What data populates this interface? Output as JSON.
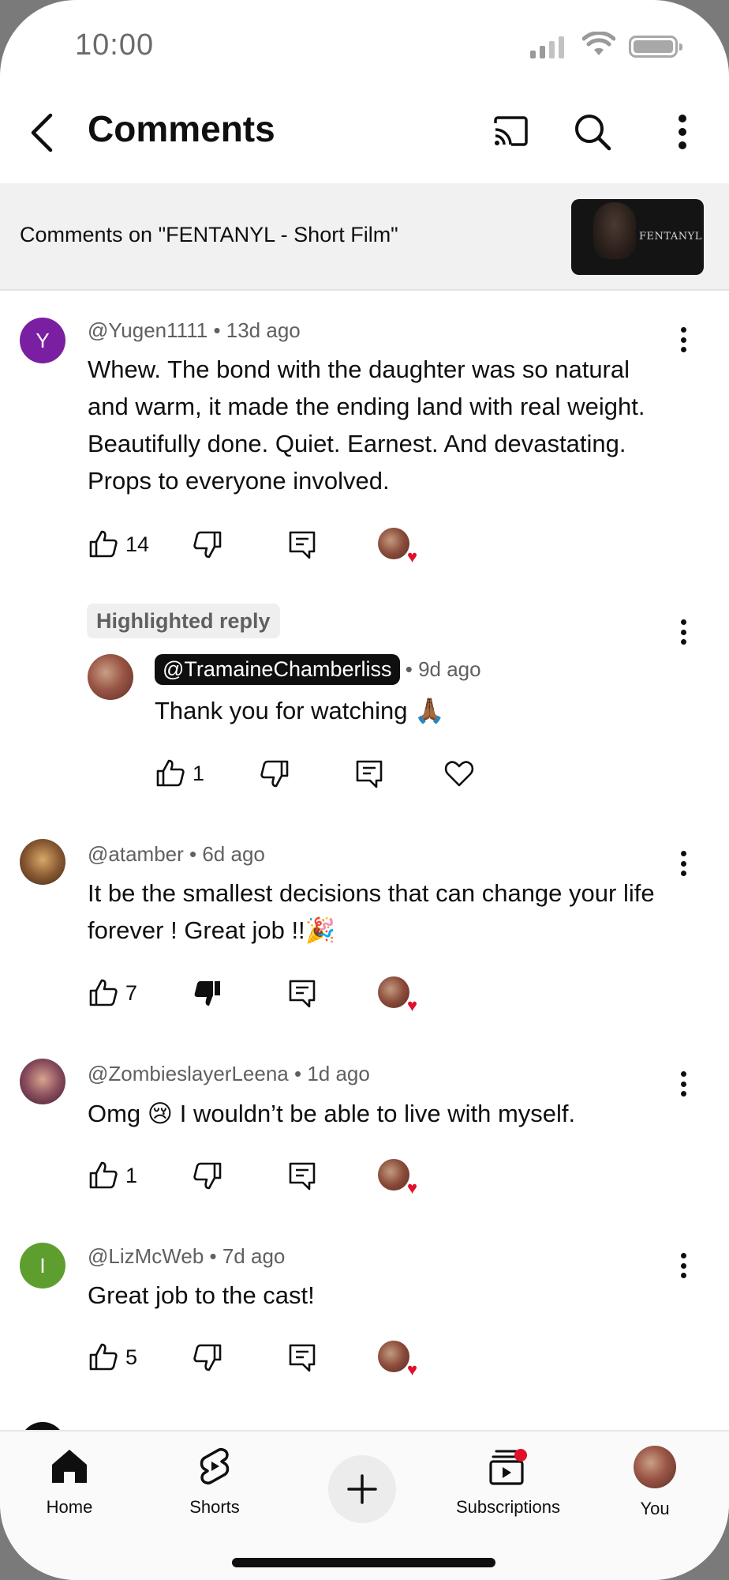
{
  "status_bar": {
    "time": "10:00"
  },
  "header": {
    "title": "Comments"
  },
  "video": {
    "label": "Comments on \"FENTANYL - Short Film\"",
    "thumb_title": "FENTANYL"
  },
  "comments": [
    {
      "avatar_letter": "Y",
      "avatar_color": "#7b1fa2",
      "author": "@Yugen1111",
      "age": "13d ago",
      "text": "Whew. The bond with the daughter was so natural and warm, it made the ending land with real weight. Beautifully done. Quiet. Earnest. And devastating. Props to everyone involved.",
      "likes": "14"
    },
    {
      "author": "@atamber",
      "age": "6d ago",
      "text": "It be the smallest decisions that can change your life forever ! Great job !!🎉",
      "likes": "7"
    },
    {
      "author": "@ZombieslayerLeena",
      "age": "1d ago",
      "text": "Omg 😢 I wouldn’t be able to live with myself.",
      "likes": "1"
    },
    {
      "avatar_letter": "I",
      "avatar_color": "#5e9e2e",
      "author": "@LizMcWeb",
      "age": "7d ago",
      "text": "Great job to the cast!",
      "likes": "5"
    }
  ],
  "highlighted_reply": {
    "chip": "Highlighted reply",
    "author": "@TramaineChamberliss",
    "age": "9d ago",
    "text": "Thank you for watching 🙏🏾",
    "likes": "1"
  },
  "nav": {
    "home": "Home",
    "shorts": "Shorts",
    "subscriptions": "Subscriptions",
    "you": "You"
  }
}
